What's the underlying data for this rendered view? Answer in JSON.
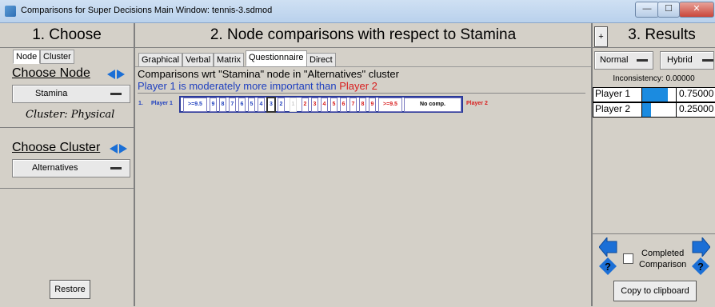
{
  "window": {
    "title": "Comparisons for Super Decisions Main Window: tennis-3.sdmod"
  },
  "choose": {
    "title": "1. Choose",
    "tabs": [
      "Node",
      "Cluster"
    ],
    "node_header": "Choose Node",
    "node_value": "Stamina",
    "cluster_note": "Cluster: Physical",
    "cluster_header": "Choose Cluster",
    "cluster_value": "Alternatives",
    "restore": "Restore"
  },
  "comparisons": {
    "title": "2. Node comparisons with respect to Stamina",
    "tabs": [
      "Graphical",
      "Verbal",
      "Matrix",
      "Questionnaire",
      "Direct"
    ],
    "active_tab": "Questionnaire",
    "heading": "Comparisons wrt \"Stamina\" node in \"Alternatives\" cluster",
    "statement": {
      "left": "Player 1",
      "middle": "is moderately more important than",
      "right": "Player 2"
    },
    "row": {
      "number": "1.",
      "left_player": "Player 1",
      "right_player": "Player 2",
      "left_values": [
        ">=9.5",
        "9",
        "8",
        "7",
        "6",
        "5",
        "4",
        "3",
        "2"
      ],
      "center_value": "1",
      "right_values": [
        "2",
        "3",
        "4",
        "5",
        "6",
        "7",
        "8",
        "9",
        ">=9.5"
      ],
      "no_comp": "No comp.",
      "selected": "3"
    }
  },
  "results": {
    "plus": "+",
    "title": "3. Results",
    "mode_normal": "Normal",
    "mode_hybrid": "Hybrid",
    "inconsistency": "Inconsistency: 0.00000",
    "rows": [
      {
        "name": "Player 1",
        "value": "0.75000",
        "weight": 0.75
      },
      {
        "name": "Player 2",
        "value": "0.25000",
        "weight": 0.25
      }
    ],
    "completed": "Completed",
    "comparison": "Comparison",
    "copy": "Copy to clipboard"
  },
  "colors": {
    "blue": "#1e3fbf",
    "red": "#d81d1d",
    "bar": "#1b8be0"
  }
}
